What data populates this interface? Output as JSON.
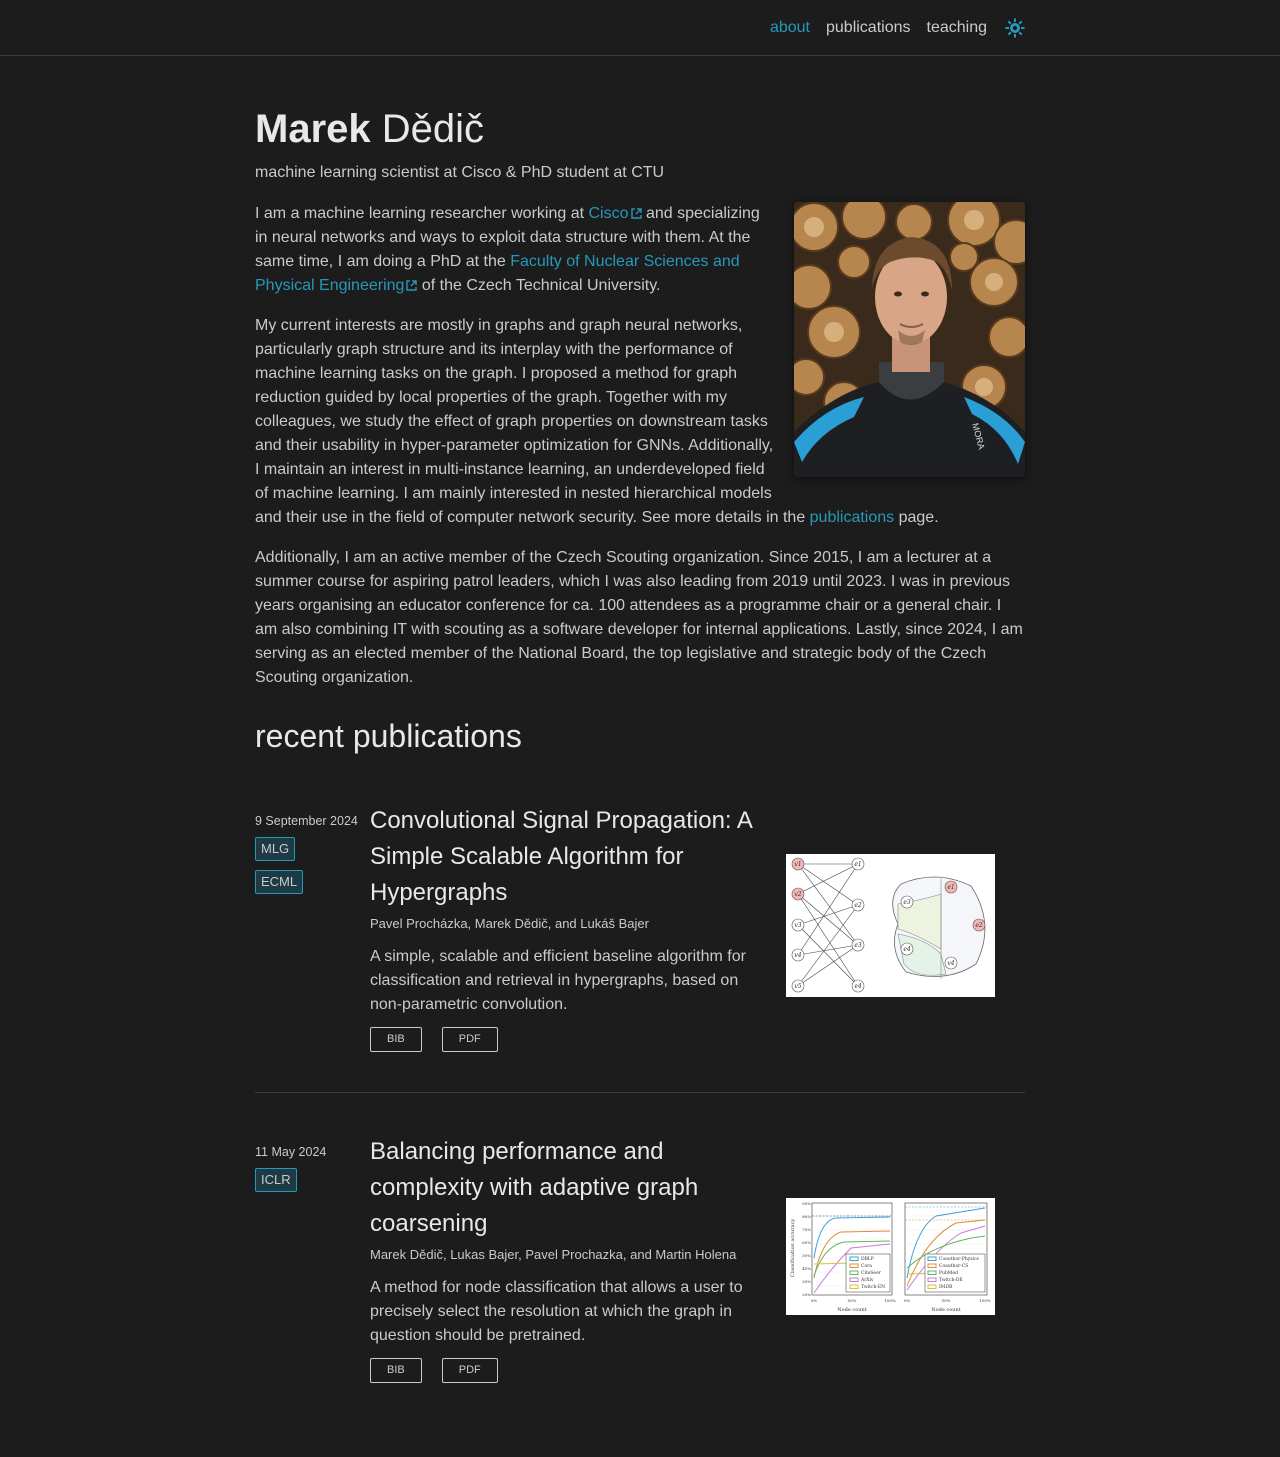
{
  "nav": {
    "items": [
      {
        "label": "about",
        "active": true
      },
      {
        "label": "publications",
        "active": false
      },
      {
        "label": "teaching",
        "active": false
      }
    ],
    "theme_icon": "sun-icon"
  },
  "header": {
    "first_name": "Marek",
    "last_name": "Dědič",
    "description": "machine learning scientist at Cisco & PhD student at CTU"
  },
  "bio": {
    "p1_a": "I am a machine learning researcher working at ",
    "p1_link1": "Cisco",
    "p1_b": " and specializing in neural networks and ways to exploit data structure with them. At the same time, I am doing a PhD at the ",
    "p1_link2": "Faculty of Nuclear Sciences and Physical Engineering",
    "p1_c": " of the Czech Technical University.",
    "p2_a": "My current interests are mostly in graphs and graph neural networks, particularly graph structure and its interplay with the performance of machine learning tasks on the graph. I proposed a method for graph reduction guided by local properties of the graph. Together with my colleagues, we study the effect of graph properties on downstream tasks and their usability in hyper-parameter optimization for GNNs. Additionally, I maintain an interest in multi-instance learning, an underdeveloped field of machine learning. I am mainly interested in nested hierarchical models and their use in the field of computer network security. See more details in the ",
    "p2_link": "publications",
    "p2_b": " page.",
    "p3": "Additionally, I am an active member of the Czech Scouting organization. Since 2015, I am a lecturer at a summer course for aspiring patrol leaders, which I was also leading from 2019 until 2023. I was in previous years organising an educator conference for ca. 100 attendees as a programme chair or a general chair. I am also combining IT with scouting as a software developer for internal applications. Lastly, since 2024, I am serving as an elected member of the National Board, the top legislative and strategic body of the Czech Scouting organization.",
    "photo_logo": "MORA"
  },
  "recent": {
    "heading": "recent publications",
    "pubs": [
      {
        "date": "9 September 2024",
        "badges": [
          "MLG",
          "ECML"
        ],
        "title": "Convolutional Signal Propagation: A Simple Scalable Algorithm for Hypergraphs",
        "authors": "Pavel Procházka, Marek Dědič, and Lukáš Bajer",
        "abstract": "A simple, scalable and efficient baseline algorithm for classification and retrieval in hypergraphs, based on non-parametric convolution.",
        "btn1": "BIB",
        "btn2": "PDF"
      },
      {
        "date": "11 May 2024",
        "badges": [
          "ICLR"
        ],
        "title": "Balancing performance and complexity with adaptive graph coarsening",
        "authors": "Marek Dědič, Lukas Bajer, Pavel Prochazka, and Martin Holena",
        "abstract": "A method for node classification that allows a user to precisely select the resolution at which the graph in question should be pretrained.",
        "btn1": "BIB",
        "btn2": "PDF"
      }
    ]
  },
  "thumb1": {
    "left_nodes": [
      "v1",
      "v2",
      "v3",
      "v4",
      "v5"
    ],
    "right_nodes": [
      "e1",
      "e2",
      "e3",
      "e4"
    ]
  },
  "thumb2": {
    "ylabel": "Classification accuracy",
    "xlabel": "Node count",
    "yticks": [
      "90%",
      "80%",
      "70%",
      "60%",
      "50%",
      "40%",
      "30%",
      "20%"
    ],
    "xticks": [
      "0%",
      "50%",
      "100%"
    ],
    "legend_left": [
      "DBLP",
      "Cora",
      "CiteSeer",
      "ArXiv",
      "Twitch-EN"
    ],
    "legend_right": [
      "Coauthor-Physics",
      "Coauthor-CS",
      "PubMed",
      "Twitch-DE",
      "IMDB"
    ],
    "colors": [
      "#3aa0d8",
      "#e08a3a",
      "#5cb85c",
      "#c77cd8",
      "#d8c23a"
    ]
  }
}
